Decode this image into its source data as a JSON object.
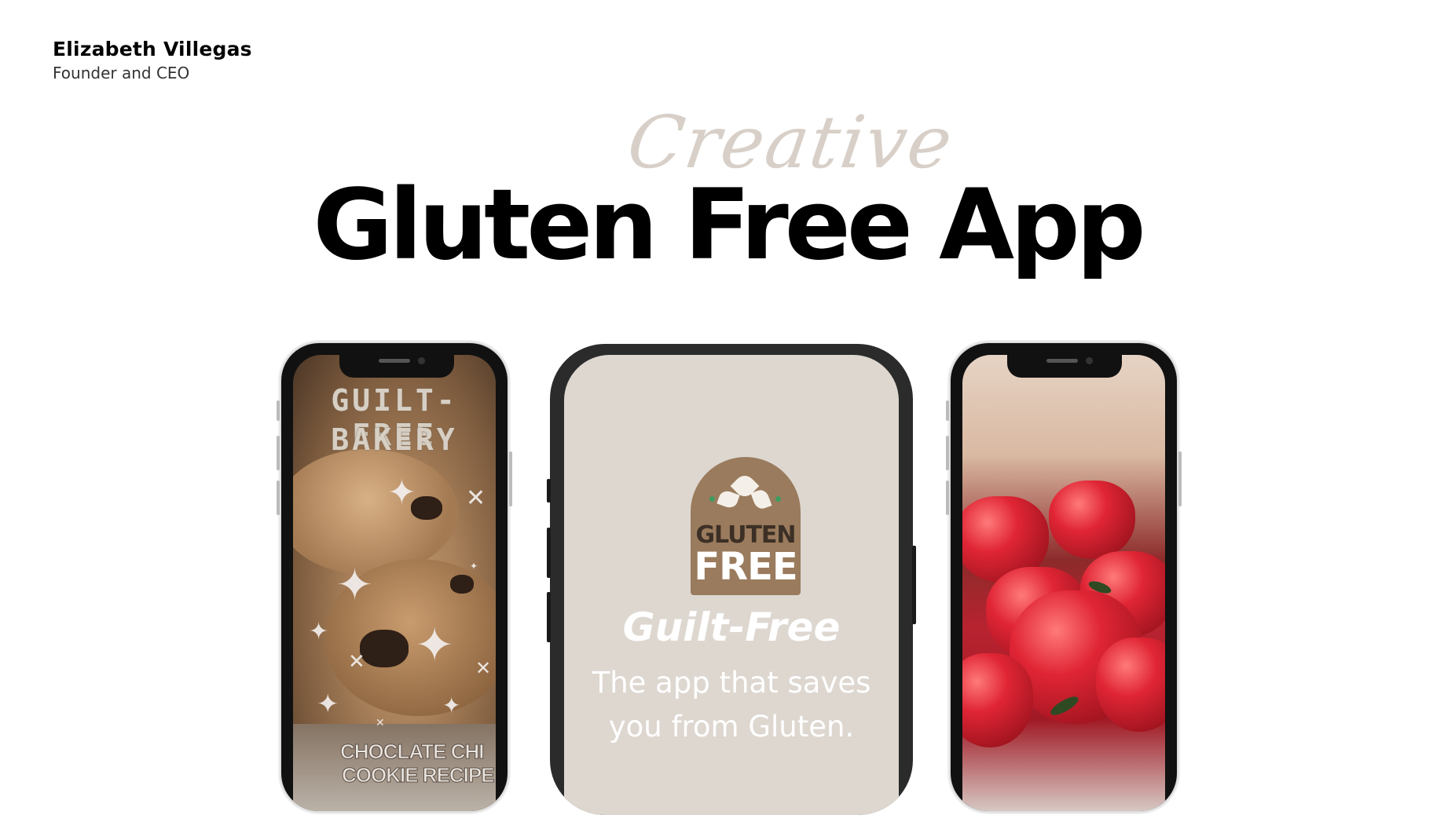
{
  "author": {
    "name": "Elizabeth Villegas",
    "role": "Founder and CEO"
  },
  "hero": {
    "script_word": "Creative",
    "title": "Gluten Free App"
  },
  "phones": {
    "left": {
      "title_line1": "GUILT-FREE",
      "title_line2": "BAKERY",
      "bottom_line1": "CHOCLATE CHI",
      "bottom_line2": "COOKIE RECIPE"
    },
    "center": {
      "badge_line1": "GLUTEN",
      "badge_line2": "FREE",
      "heading": "Guilt-Free",
      "subline1": "The app that saves",
      "subline2": "you from Gluten."
    }
  },
  "colors": {
    "script_word": "#d8d0c8",
    "center_screen_bg": "#ddd7d0",
    "badge_bg": "#9a7b5d"
  }
}
